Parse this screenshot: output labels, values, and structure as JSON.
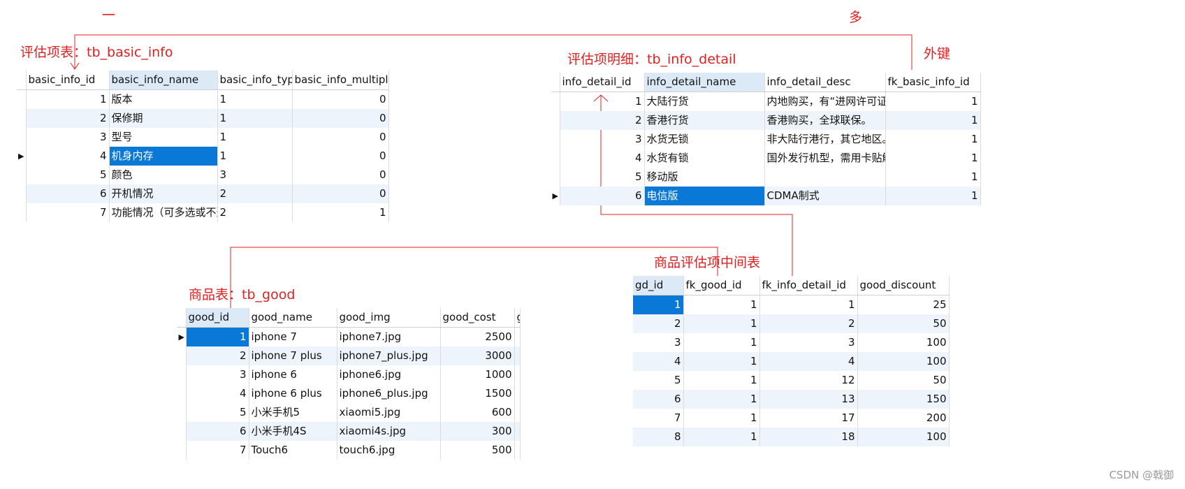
{
  "annotations": {
    "one": "一",
    "many": "多",
    "foreign_key": "外键",
    "tb_basic_info_title": "评估项表：tb_basic_info",
    "tb_info_detail_title": "评估项明细：tb_info_detail",
    "tb_good_title": "商品表：tb_good",
    "mid_table_title": "商品评估项中间表"
  },
  "tb_basic_info": {
    "columns": [
      "basic_info_id",
      "basic_info_name",
      "basic_info_type",
      "basic_info_multiple"
    ],
    "rows": [
      [
        "1",
        "版本",
        "1",
        "0"
      ],
      [
        "2",
        "保修期",
        "1",
        "0"
      ],
      [
        "3",
        "型号",
        "1",
        "0"
      ],
      [
        "4",
        "机身内存",
        "1",
        "0"
      ],
      [
        "5",
        "颜色",
        "3",
        "0"
      ],
      [
        "6",
        "开机情况",
        "2",
        "0"
      ],
      [
        "7",
        "功能情况（可多选或不选",
        "2",
        "1"
      ]
    ]
  },
  "tb_info_detail": {
    "columns": [
      "info_detail_id",
      "info_detail_name",
      "info_detail_desc",
      "fk_basic_info_id"
    ],
    "rows": [
      [
        "1",
        "大陆行货",
        "内地购买，有“进网许可证”标",
        "1"
      ],
      [
        "2",
        "香港行货",
        "香港购买，全球联保。",
        "1"
      ],
      [
        "3",
        "水货无锁",
        "非大陆行港行，其它地区。",
        "1"
      ],
      [
        "4",
        "水货有锁",
        "国外发行机型，需用卡贴解锁",
        "1"
      ],
      [
        "5",
        "移动版",
        "",
        "1"
      ],
      [
        "6",
        "电信版",
        "CDMA制式",
        "1"
      ]
    ]
  },
  "tb_good": {
    "columns": [
      "good_id",
      "good_name",
      "good_img",
      "good_cost",
      "g"
    ],
    "rows": [
      [
        "1",
        "iphone 7",
        "iphone7.jpg",
        "2500"
      ],
      [
        "2",
        "iphone 7 plus",
        "iphone7_plus.jpg",
        "3000"
      ],
      [
        "3",
        "iphone 6",
        "iphone6.jpg",
        "1000"
      ],
      [
        "4",
        "iphone 6 plus",
        "iphone6_plus.jpg",
        "1500"
      ],
      [
        "5",
        "小米手机5",
        "xiaomi5.jpg",
        "600"
      ],
      [
        "6",
        "小米手机4S",
        "xiaomi4s.jpg",
        "300"
      ],
      [
        "7",
        "Touch6",
        "touch6.jpg",
        "500"
      ]
    ]
  },
  "tb_good_detail": {
    "columns": [
      "gd_id",
      "fk_good_id",
      "fk_info_detail_id",
      "good_discount"
    ],
    "rows": [
      [
        "1",
        "1",
        "1",
        "25"
      ],
      [
        "2",
        "1",
        "2",
        "50"
      ],
      [
        "3",
        "1",
        "3",
        "100"
      ],
      [
        "4",
        "1",
        "4",
        "100"
      ],
      [
        "5",
        "1",
        "12",
        "50"
      ],
      [
        "6",
        "1",
        "13",
        "150"
      ],
      [
        "7",
        "1",
        "17",
        "200"
      ],
      [
        "8",
        "1",
        "18",
        "100"
      ]
    ]
  },
  "watermark": "CSDN @戟御",
  "colors": {
    "annotation": "#e02020",
    "selection": "#0a78d7",
    "header_selected": "#dce9f7",
    "row_alt": "#eef4fb"
  }
}
